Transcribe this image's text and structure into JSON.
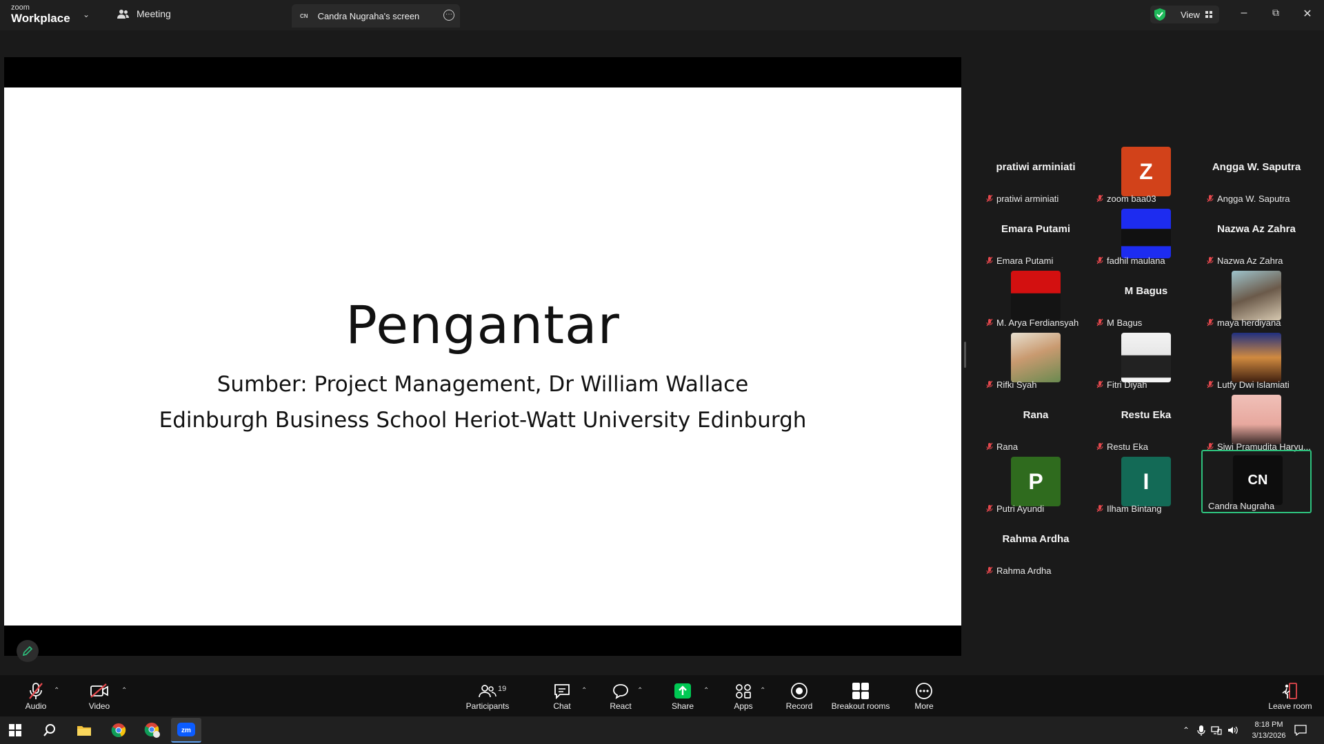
{
  "titlebar": {
    "brand_top": "zoom",
    "brand_bottom": "Workplace",
    "meeting_tab": "Meeting",
    "screen_tab_badge": "CN",
    "screen_tab": "Candra Nugraha's screen",
    "view_label": "View"
  },
  "slide": {
    "title": "Pengantar",
    "line1": "Sumber: Project Management, Dr William Wallace",
    "line2": "Edinburgh Business School Heriot-Watt University Edinburgh"
  },
  "participants": [
    {
      "display": "pratiwi arminiati",
      "tag": "pratiwi arminiati",
      "type": "name"
    },
    {
      "display": "Z",
      "tag": "zoom baa03",
      "type": "initial",
      "color": "#d2421a"
    },
    {
      "display": "Angga W. Saputra",
      "tag": "Angga W. Saputra",
      "type": "name"
    },
    {
      "display": "Emara Putami",
      "tag": "Emara Putami",
      "type": "name"
    },
    {
      "display": "",
      "tag": "fadhil maulana",
      "type": "photo",
      "photo": "blue-photo"
    },
    {
      "display": "Nazwa Az Zahra",
      "tag": "Nazwa Az Zahra",
      "type": "name"
    },
    {
      "display": "",
      "tag": "M. Arya Ferdiansyah",
      "type": "photo",
      "photo": "red-photo"
    },
    {
      "display": "M Bagus",
      "tag": "M Bagus",
      "type": "name"
    },
    {
      "display": "",
      "tag": "maya herdiyana",
      "type": "photo",
      "photo": "hijab-photo"
    },
    {
      "display": "",
      "tag": "Rifki Syah",
      "type": "photo",
      "photo": "floral-photo"
    },
    {
      "display": "",
      "tag": "Fitri Diyah",
      "type": "photo",
      "photo": "white-photo"
    },
    {
      "display": "",
      "tag": "Lutfy Dwi Islamiati",
      "type": "photo",
      "photo": "night-photo"
    },
    {
      "display": "Rana",
      "tag": "Rana",
      "type": "name"
    },
    {
      "display": "Restu Eka",
      "tag": "Restu Eka",
      "type": "name"
    },
    {
      "display": "",
      "tag": "Siwi Pramudita Haryu...",
      "type": "photo",
      "photo": "face-photo"
    },
    {
      "display": "P",
      "tag": "Putri Ayundi",
      "type": "initial",
      "color": "#2f6b1e"
    },
    {
      "display": "I",
      "tag": "Ilham Bintang",
      "type": "initial",
      "color": "#136a56"
    },
    {
      "display": "CN",
      "tag": "Candra Nugraha",
      "type": "initial",
      "color": "#0d0d0d",
      "active": true
    },
    {
      "display": "Rahma Ardha",
      "tag": "Rahma Ardha",
      "type": "name"
    }
  ],
  "toolbar": {
    "audio": "Audio",
    "video": "Video",
    "participants": "Participants",
    "participants_count": "19",
    "chat": "Chat",
    "react": "React",
    "share": "Share",
    "apps": "Apps",
    "record": "Record",
    "breakout": "Breakout rooms",
    "more": "More",
    "leave": "Leave room"
  },
  "taskbar": {
    "time": "8:18 PM",
    "date": "3/13/2026"
  },
  "colors": {
    "share_green": "#00c853",
    "active_border": "#2ec27e",
    "muted_red": "#e5484d"
  }
}
